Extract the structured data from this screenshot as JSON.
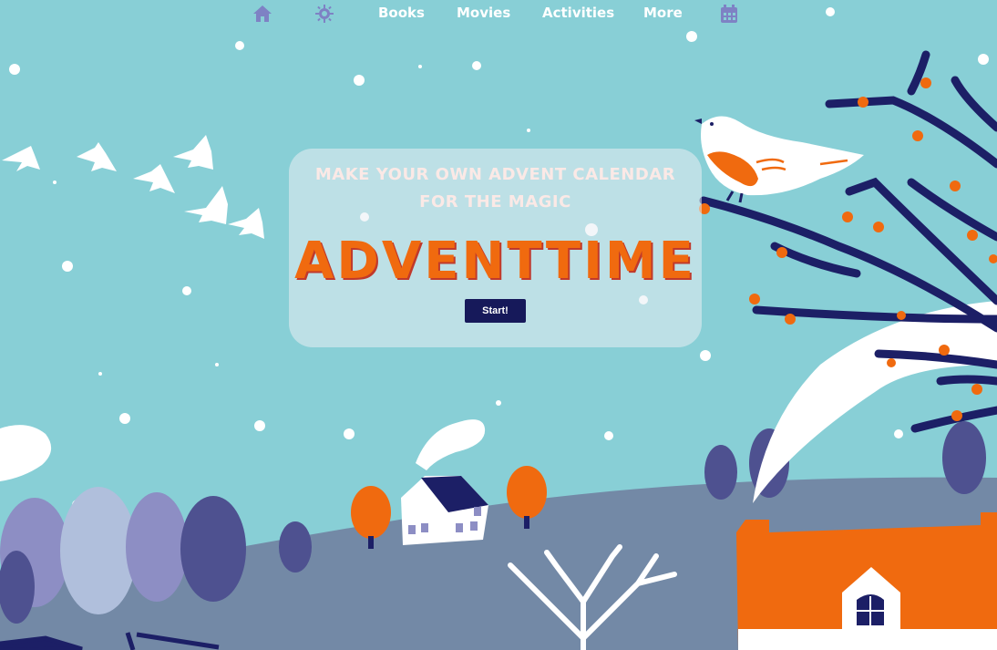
{
  "nav": {
    "home_icon": "home-icon",
    "settings_icon": "gear-icon",
    "books": "Books",
    "movies": "Movies",
    "activities": "Activities",
    "more": "More",
    "calendar_icon": "calendar-icon"
  },
  "hero": {
    "tagline_line1": "MAKE YOUR OWN ADVENT CALENDAR",
    "tagline_line2": "FOR THE MAGIC",
    "brand": "ADVENTTIME",
    "start_label": "Start!"
  },
  "colors": {
    "sky": "#88cfd6",
    "nav_icon": "#7e82c4",
    "brand_orange": "#f06a0f",
    "button": "#16195a",
    "branch": "#1c1f66"
  }
}
